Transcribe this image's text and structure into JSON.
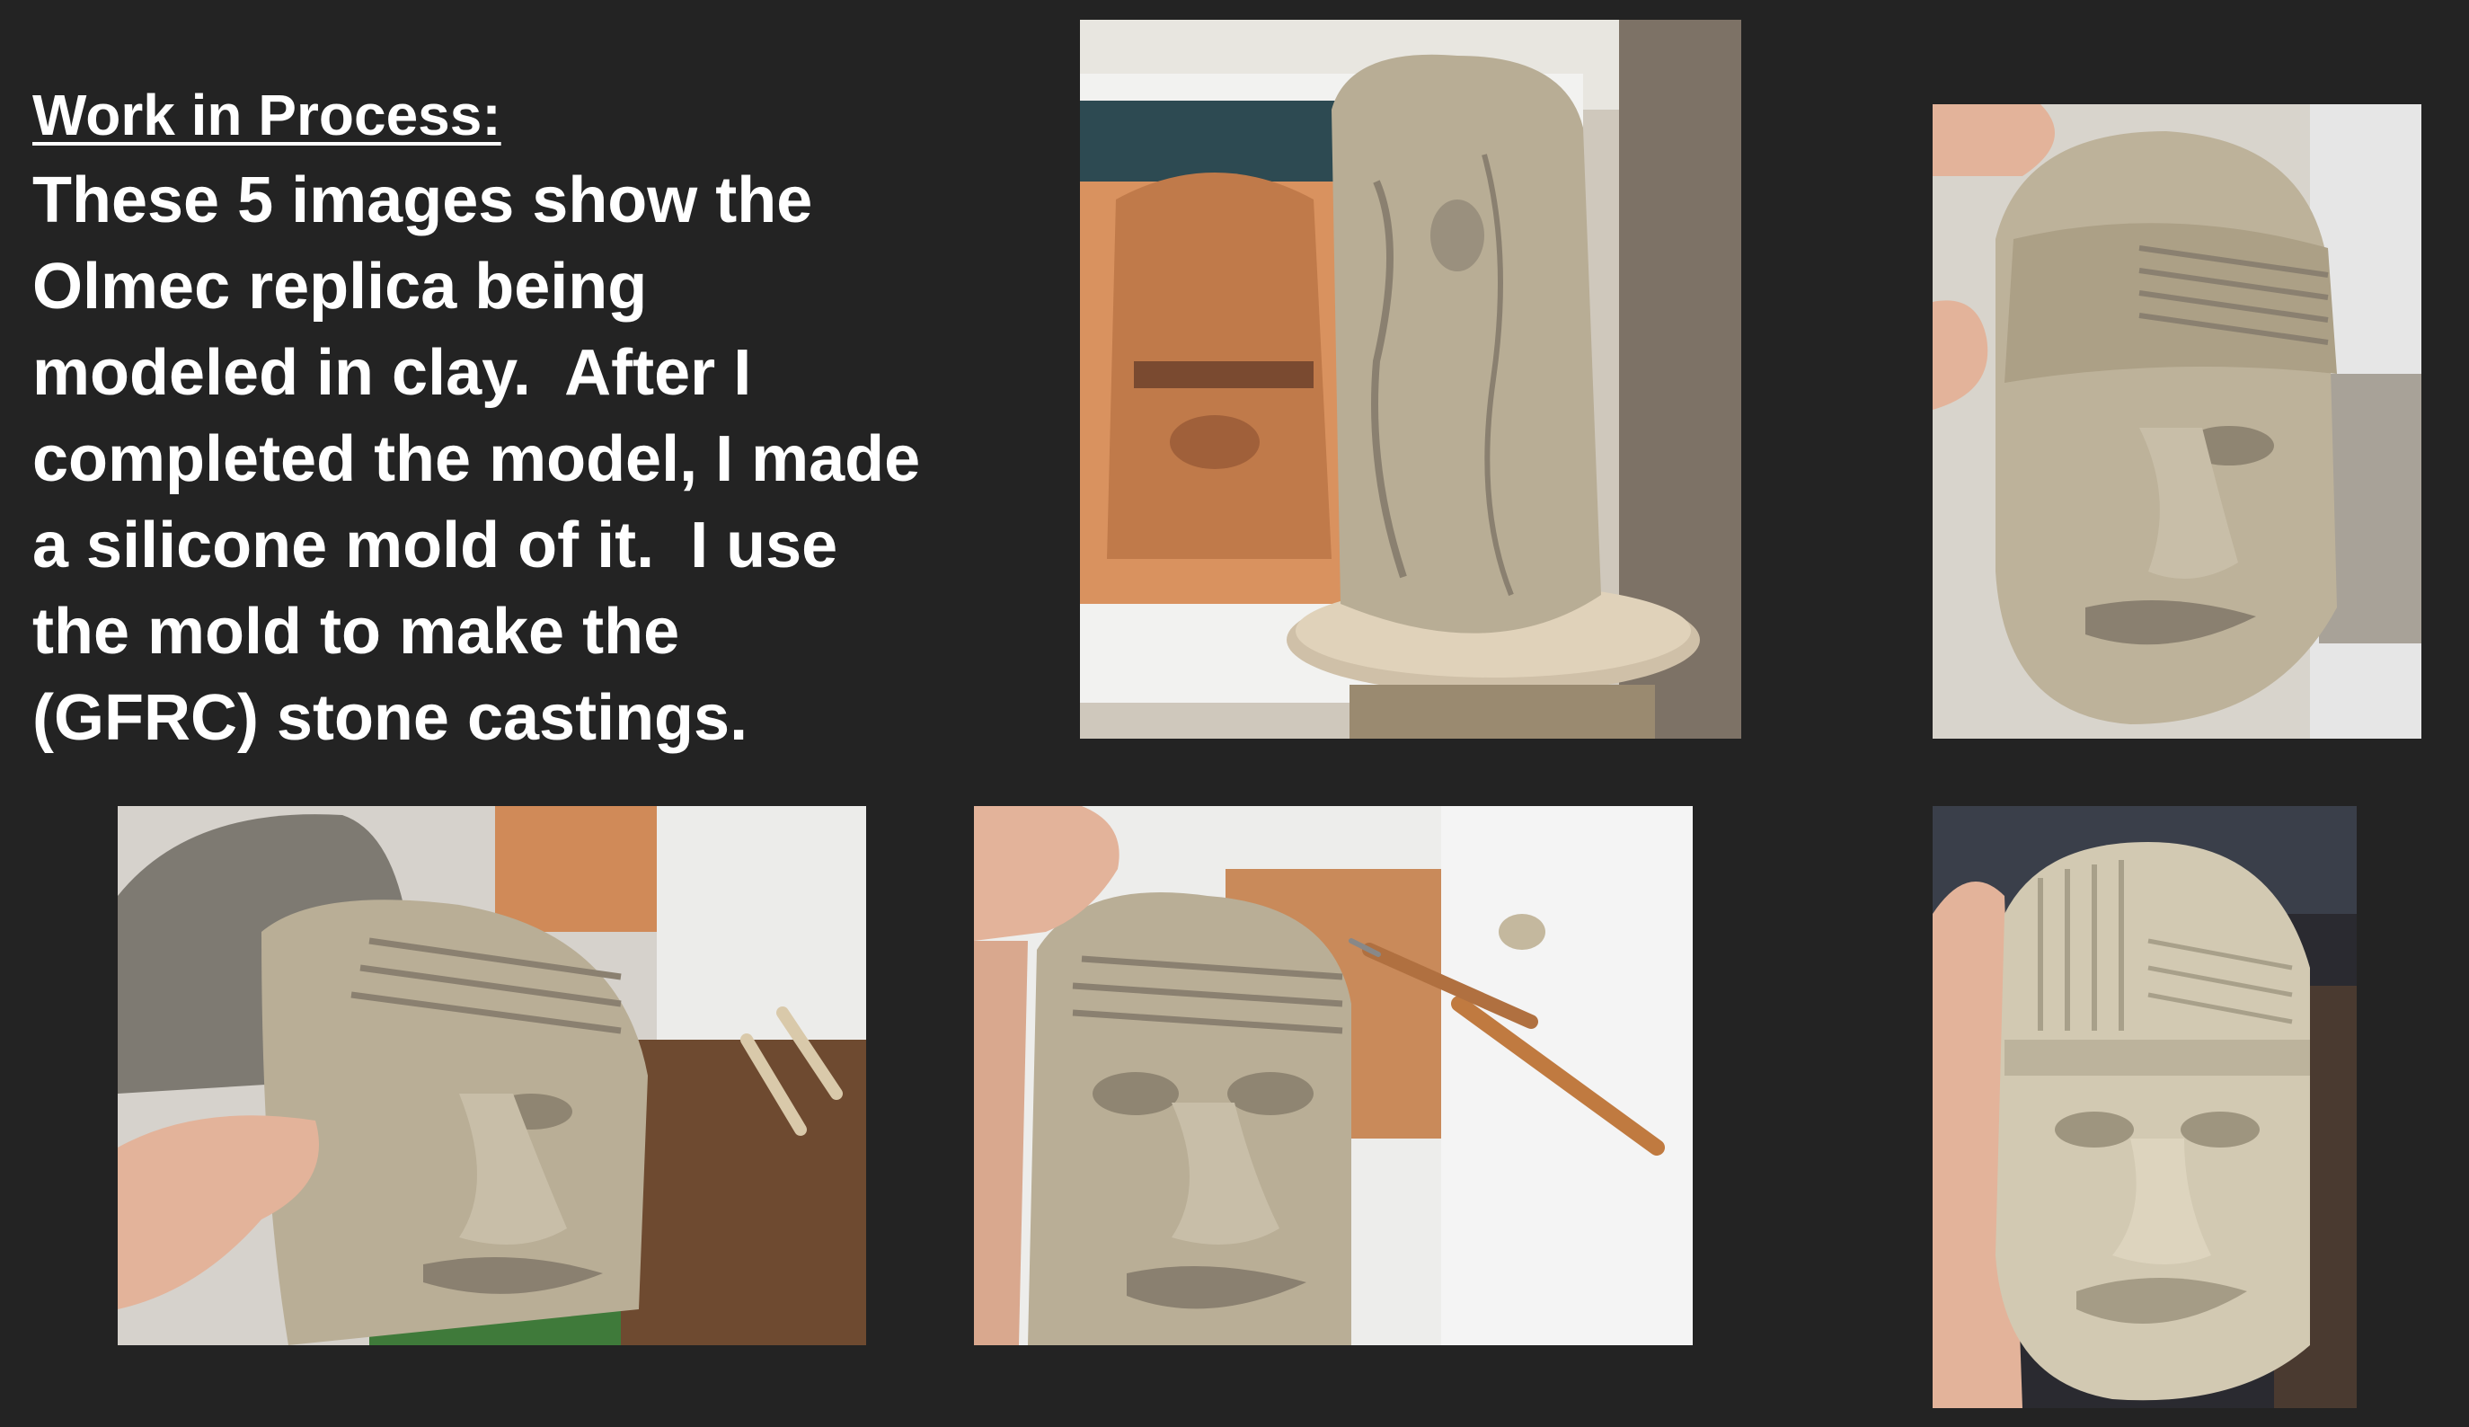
{
  "heading": "Work in Process:",
  "body_lines": [
    "These 5 images show the",
    "Olmec replica being",
    "modeled in clay.  After I",
    "completed the model, I made",
    "a silicone mold of it.  I use",
    "the mold to make the",
    "(GFRC) stone castings."
  ],
  "colors": {
    "background": "#232323",
    "text": "#ffffff",
    "clay": "#b8ad95",
    "clay_shadow": "#8a8070",
    "skin": "#e0b8a0",
    "paper": "#eeeeee",
    "terracotta": "#c98a5a"
  },
  "photos": [
    {
      "id": "photo-clay-block-on-base",
      "subject": "rough clay block on wooden disc"
    },
    {
      "id": "photo-head-held-in-hand",
      "subject": "partially modeled clay head held in hand"
    },
    {
      "id": "photo-head-early-features",
      "subject": "clay head with early facial features"
    },
    {
      "id": "photo-head-detailing-with-tools",
      "subject": "clay head being detailed, sculpting tools"
    },
    {
      "id": "photo-finished-stone-casting",
      "subject": "finished stone casting held in hand"
    }
  ]
}
